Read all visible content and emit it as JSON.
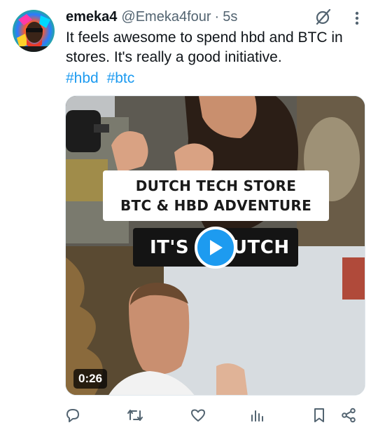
{
  "tweet": {
    "author_name": "emeka4",
    "handle": "@Emeka4four",
    "separator": "·",
    "time": "5s",
    "text": "It feels awesome to spend hbd and BTC in stores. It's really a good initiative.",
    "hashtags": [
      "#hbd",
      "#btc"
    ]
  },
  "media": {
    "title_line1": "DUTCH TECH STORE",
    "title_line2": "BTC & HBD ADVENTURE",
    "subtitle": "IT'S A DUTCH",
    "duration": "0:26"
  },
  "icons": {
    "header": [
      "grok-icon",
      "more-icon"
    ],
    "actions": [
      "reply-icon",
      "retweet-icon",
      "like-icon",
      "views-icon",
      "bookmark-icon",
      "share-icon"
    ]
  },
  "colors": {
    "accent": "#1d9bf0",
    "text": "#0f1419",
    "secondary": "#536471"
  }
}
